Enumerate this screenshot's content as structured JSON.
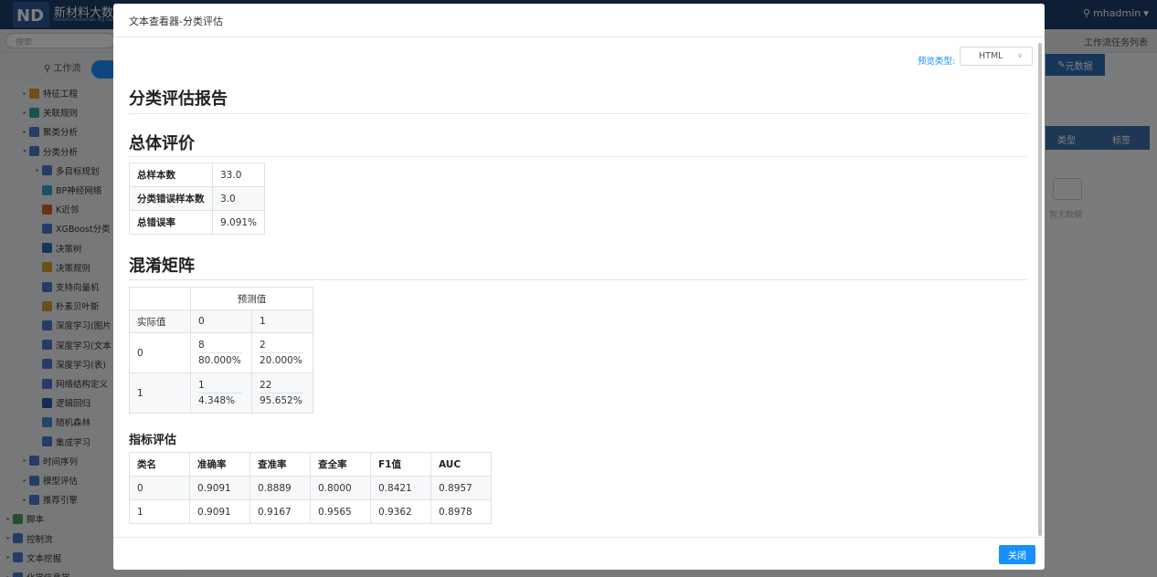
{
  "app": {
    "brand": "新材料大数据",
    "brand_sub": "National materials Big Data",
    "user": "mhadmin",
    "search_placeholder": "搜索",
    "task_list": "工作流任务列表",
    "workflow_tab": "工作流",
    "meta_button": "元数据",
    "grid_headers": [
      "类型",
      "标签"
    ],
    "empty_text": "暂无数据"
  },
  "sidebar": {
    "items": [
      {
        "label": "特征工程",
        "arrow": "▸"
      },
      {
        "label": "关联规则",
        "arrow": "▸"
      },
      {
        "label": "聚类分析",
        "arrow": "▸"
      },
      {
        "label": "分类分析",
        "arrow": "▾"
      },
      {
        "label": "多目标规划",
        "arrow": "▸"
      },
      {
        "label": "BP神经网络",
        "arrow": ""
      },
      {
        "label": "K近邻",
        "arrow": ""
      },
      {
        "label": "XGBoost分类",
        "arrow": ""
      },
      {
        "label": "决策树",
        "arrow": ""
      },
      {
        "label": "决策规则",
        "arrow": ""
      },
      {
        "label": "支持向量机",
        "arrow": ""
      },
      {
        "label": "朴素贝叶斯",
        "arrow": ""
      },
      {
        "label": "深度学习(图片",
        "arrow": ""
      },
      {
        "label": "深度学习(文本",
        "arrow": ""
      },
      {
        "label": "深度学习(表)",
        "arrow": ""
      },
      {
        "label": "网络结构定义",
        "arrow": ""
      },
      {
        "label": "逻辑回归",
        "arrow": ""
      },
      {
        "label": "随机森林",
        "arrow": ""
      },
      {
        "label": "集成学习",
        "arrow": ""
      },
      {
        "label": "时间序列",
        "arrow": "▸"
      },
      {
        "label": "模型评估",
        "arrow": "▸"
      },
      {
        "label": "推荐引擎",
        "arrow": "▸"
      },
      {
        "label": "脚本",
        "arrow": "▸"
      },
      {
        "label": "控制流",
        "arrow": "▸"
      },
      {
        "label": "文本挖掘",
        "arrow": "▸"
      },
      {
        "label": "化学信息学",
        "arrow": "▸"
      }
    ]
  },
  "modal": {
    "title": "文本查看器-分类评估",
    "preview_label": "预览类型:",
    "preview_value": "HTML",
    "close_label": "关闭"
  },
  "report": {
    "title": "分类评估报告",
    "summary_title": "总体评价",
    "summary": [
      {
        "key": "总样本数",
        "value": "33.0"
      },
      {
        "key": "分类错误样本数",
        "value": "3.0"
      },
      {
        "key": "总错误率",
        "value": "9.091%"
      }
    ],
    "confusion_title": "混淆矩阵",
    "confusion": {
      "predicted_header": "预测值",
      "actual_header": "实际值",
      "columns": [
        "0",
        "1"
      ],
      "rows": [
        {
          "label": "0",
          "cells": [
            {
              "count": "8",
              "pct": "80.000%"
            },
            {
              "count": "2",
              "pct": "20.000%"
            }
          ]
        },
        {
          "label": "1",
          "cells": [
            {
              "count": "1",
              "pct": "4.348%"
            },
            {
              "count": "22",
              "pct": "95.652%"
            }
          ]
        }
      ]
    },
    "metrics_title": "指标评估",
    "metrics": {
      "headers": [
        "类名",
        "准确率",
        "查准率",
        "查全率",
        "F1值",
        "AUC"
      ],
      "rows": [
        [
          "0",
          "0.9091",
          "0.8889",
          "0.8000",
          "0.8421",
          "0.8957"
        ],
        [
          "1",
          "0.9091",
          "0.9167",
          "0.9565",
          "0.9362",
          "0.8978"
        ]
      ]
    }
  },
  "colors": {
    "topbar": "#1a3d6b",
    "primary": "#1890ff",
    "overlay": "rgba(0,0,0,0.5)"
  }
}
